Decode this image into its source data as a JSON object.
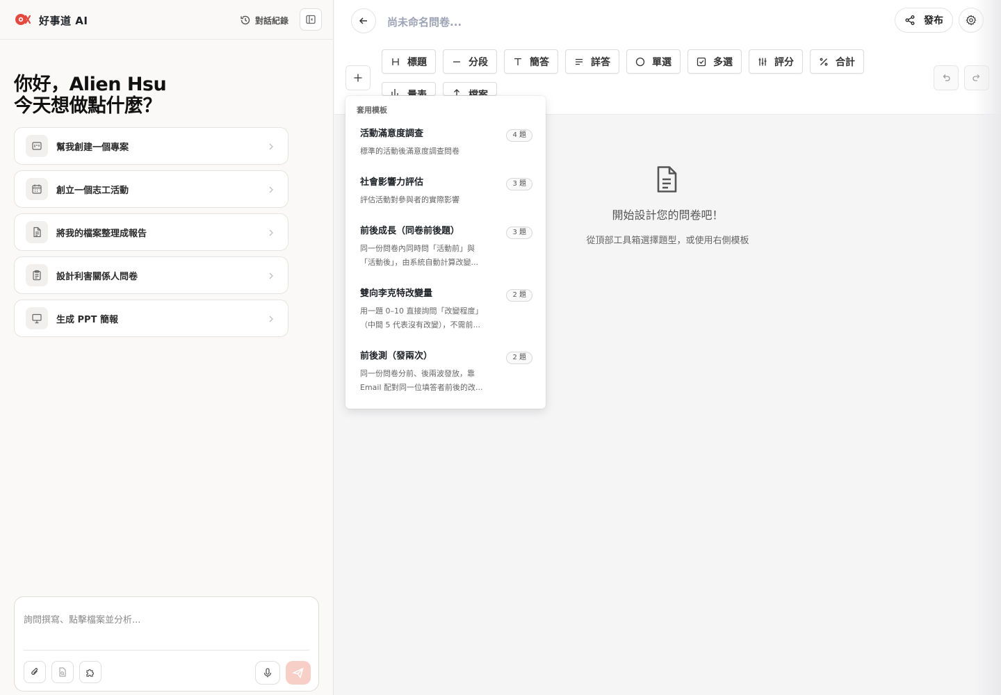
{
  "sidebar": {
    "app_name": "好事道 AI",
    "history_label": "對話紀錄",
    "greeting_line1": "你好，Alien Hsu",
    "greeting_line2": "今天想做點什麼？",
    "suggestions": [
      {
        "label": "幫我創建一個專案",
        "icon": "project-board-icon"
      },
      {
        "label": "創立一個志工活動",
        "icon": "calendar-icon"
      },
      {
        "label": "將我的檔案整理成報告",
        "icon": "document-icon"
      },
      {
        "label": "設計利害關係人問卷",
        "icon": "clipboard-icon"
      },
      {
        "label": "生成 PPT 簡報",
        "icon": "presentation-icon"
      }
    ],
    "composer": {
      "placeholder": "詢問撰寫、點擊檔案並分析..."
    }
  },
  "editor": {
    "title": "尚未命名問卷...",
    "publish_label": "發布",
    "tools": [
      {
        "label": "標題",
        "icon": "heading-icon"
      },
      {
        "label": "分段",
        "icon": "divider-icon"
      },
      {
        "label": "簡答",
        "icon": "text-icon"
      },
      {
        "label": "詳答",
        "icon": "paragraph-icon"
      },
      {
        "label": "單選",
        "icon": "radio-icon"
      },
      {
        "label": "多選",
        "icon": "checkbox-icon"
      },
      {
        "label": "評分",
        "icon": "sliders-icon"
      },
      {
        "label": "合計",
        "icon": "percent-icon"
      }
    ],
    "tools_row2": [
      {
        "label": "量表",
        "icon": "scale-icon"
      },
      {
        "label": "檔案",
        "icon": "upload-icon"
      }
    ],
    "empty_title": "開始設計您的問卷吧！",
    "empty_subtitle": "從頂部工具箱選擇題型，或使用右側模板"
  },
  "templates": {
    "header": "套用模板",
    "items": [
      {
        "title": "活動滿意度調查",
        "badge": "4 題",
        "desc": "標準的活動後滿意度調查問卷"
      },
      {
        "title": "社會影響力評估",
        "badge": "3 題",
        "desc": "評估活動對參與者的實際影響"
      },
      {
        "title": "前後成長（同卷前後題）",
        "badge": "3 題",
        "desc_line1": "同一份問卷內同時問「活動前」與",
        "desc_line2": "「活動後」，由系統自動計算改變..."
      },
      {
        "title": "雙向李克特改變量",
        "badge": "2 題",
        "desc_line1": "用一題 0–10 直接詢問「改變程度」",
        "desc_line2": "（中間 5 代表沒有改變），不需前..."
      },
      {
        "title": "前後測（發兩次）",
        "badge": "2 題",
        "desc_line1": "同一份問卷分前、後兩波發放，靠",
        "desc_line2": "Email 配對同一位填答者前後的改..."
      }
    ]
  },
  "colors": {
    "brand": "#e5483e",
    "send_button": "#f7cfc7",
    "placeholder_title": "#9ba3b4"
  }
}
